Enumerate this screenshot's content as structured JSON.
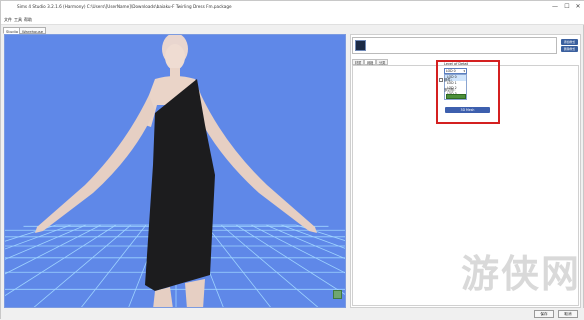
{
  "window": {
    "title": "Sims 4 Studio 3.2.1.6 (Harmony)  C:\\Users\\[UserName]\\Downloads\\baiaku-F Twirling Dress Fm.package",
    "controls": {
      "minimize": "—",
      "maximize": "☐",
      "close": "✕"
    }
  },
  "menu": {
    "items": [
      "文件",
      "工具",
      "帮助"
    ]
  },
  "view_tabs": [
    {
      "label": "Studio",
      "active": true
    },
    {
      "label": "Warehouse",
      "active": false
    }
  ],
  "viewport": {
    "background_color": "#5f88e8",
    "grid_color": "#9ed3ff",
    "corner_icon": "green-toggle-icon"
  },
  "right_panel": {
    "thumbnail_icon": "swatch-thumbnail-icon",
    "side_buttons": [
      "添加样式",
      "删除样式"
    ],
    "subtabs": [
      {
        "label": "材质",
        "active": false
      },
      {
        "label": "网格",
        "active": true
      },
      {
        "label": "分类",
        "active": false
      }
    ],
    "lod": {
      "label": "Level of Detail",
      "selected": "LOD 0",
      "options": [
        "LOD 0",
        "LOD 1",
        "LOD 2",
        "LOD 3"
      ]
    },
    "row_label_1": "部件：",
    "row_label_2": "多边形：",
    "apply_button": "3D Mesh",
    "highlight_color": "#d42020"
  },
  "watermark": {
    "chars": [
      "游",
      "侠",
      "网"
    ]
  },
  "footer": {
    "buttons": [
      "保存",
      "取消"
    ]
  }
}
